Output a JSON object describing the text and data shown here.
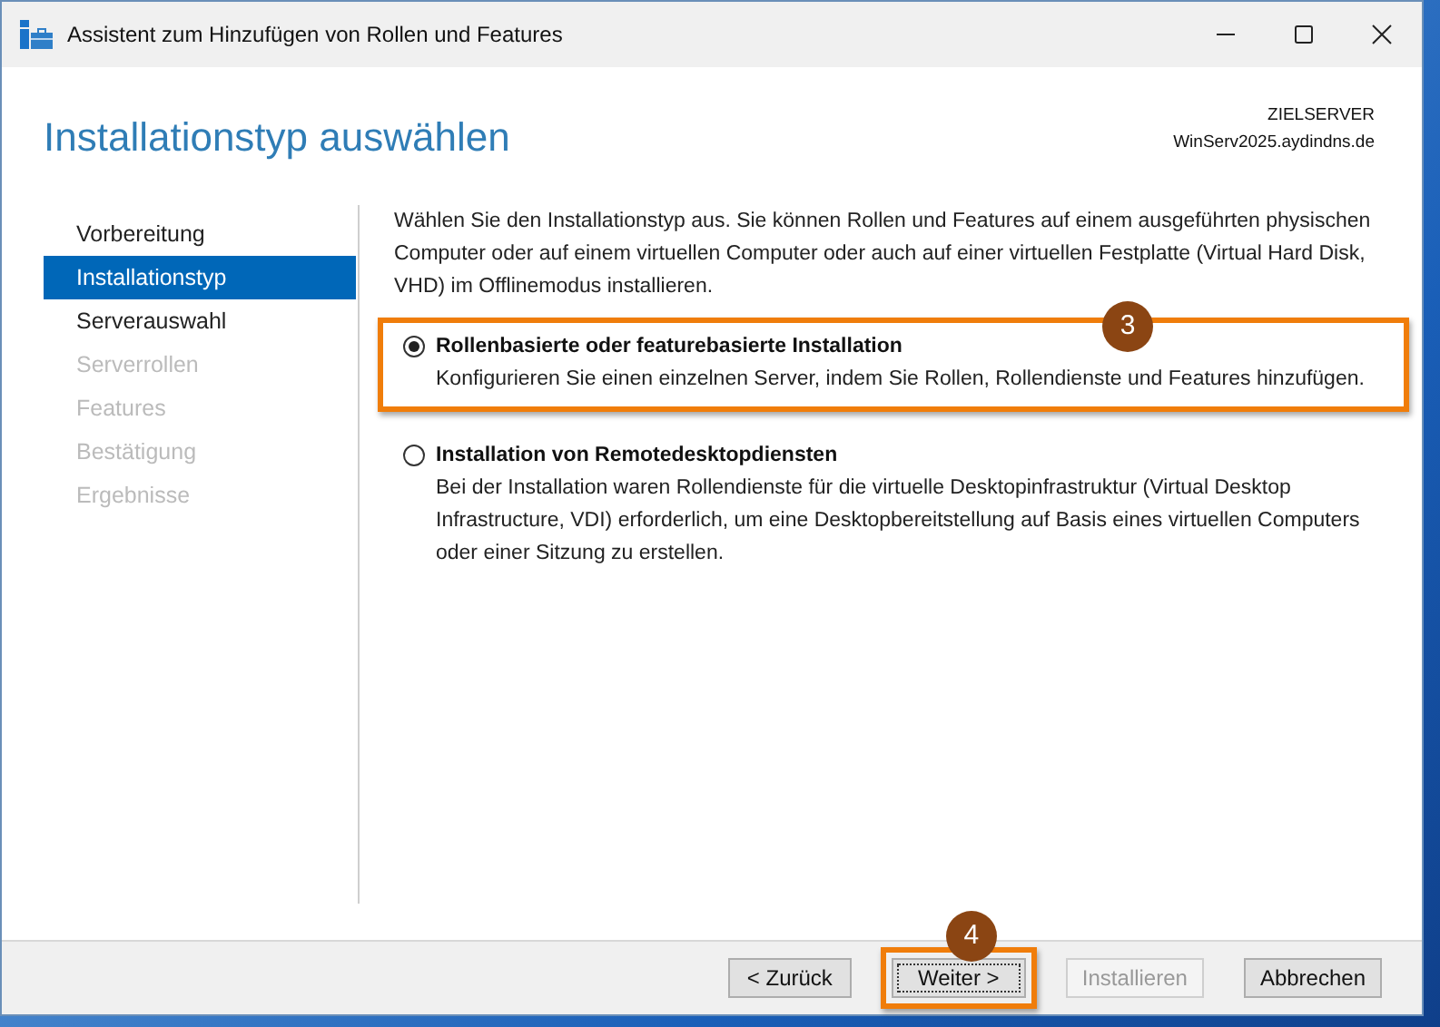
{
  "window": {
    "title": "Assistent zum Hinzufügen von Rollen und Features"
  },
  "header": {
    "title": "Installationstyp auswählen",
    "server_label": "ZIELSERVER",
    "server_name": "WinServ2025.aydindns.de"
  },
  "sidebar": {
    "items": [
      {
        "label": "Vorbereitung",
        "selected": false,
        "disabled": false
      },
      {
        "label": "Installationstyp",
        "selected": true,
        "disabled": false
      },
      {
        "label": "Serverauswahl",
        "selected": false,
        "disabled": false
      },
      {
        "label": "Serverrollen",
        "selected": false,
        "disabled": true
      },
      {
        "label": "Features",
        "selected": false,
        "disabled": true
      },
      {
        "label": "Bestätigung",
        "selected": false,
        "disabled": true
      },
      {
        "label": "Ergebnisse",
        "selected": false,
        "disabled": true
      }
    ]
  },
  "content": {
    "intro": "Wählen Sie den Installationstyp aus. Sie können Rollen und Features auf einem ausgeführten physischen Computer oder auf einem virtuellen Computer oder auch auf einer virtuellen Festplatte (Virtual Hard Disk, VHD) im Offlinemodus installieren.",
    "options": [
      {
        "label": "Rollenbasierte oder featurebasierte Installation",
        "description": "Konfigurieren Sie einen einzelnen Server, indem Sie Rollen, Rollendienste und Features hinzufügen.",
        "selected": true,
        "highlighted": true,
        "badge": "3"
      },
      {
        "label": "Installation von Remotedesktopdiensten",
        "description": "Bei der Installation waren Rollendienste für die virtuelle Desktopinfrastruktur (Virtual Desktop Infrastructure, VDI) erforderlich, um eine Desktopbereitstellung auf Basis eines virtuellen Computers oder einer Sitzung zu erstellen.",
        "selected": false,
        "highlighted": false
      }
    ]
  },
  "buttons": [
    {
      "label": "< Zurück",
      "disabled": false,
      "focused": false,
      "highlighted": false
    },
    {
      "label": "Weiter >",
      "disabled": false,
      "focused": true,
      "highlighted": true,
      "badge": "4"
    },
    {
      "label": "Installieren",
      "disabled": true,
      "focused": false,
      "highlighted": false
    },
    {
      "label": "Abbrechen",
      "disabled": false,
      "focused": false,
      "highlighted": false
    }
  ]
}
